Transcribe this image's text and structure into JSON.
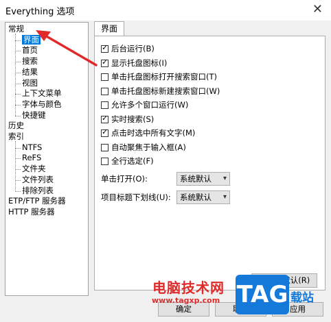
{
  "window": {
    "title": "Everything 选项",
    "close_icon": "close-icon"
  },
  "tree": {
    "items": [
      {
        "label": "常规",
        "level": 0
      },
      {
        "label": "界面",
        "level": 1,
        "selected": true
      },
      {
        "label": "首页",
        "level": 1
      },
      {
        "label": "搜索",
        "level": 1
      },
      {
        "label": "结果",
        "level": 1
      },
      {
        "label": "视图",
        "level": 1
      },
      {
        "label": "上下文菜单",
        "level": 1
      },
      {
        "label": "字体与颜色",
        "level": 1
      },
      {
        "label": "快捷键",
        "level": 1
      },
      {
        "label": "历史",
        "level": 0
      },
      {
        "label": "索引",
        "level": 0
      },
      {
        "label": "NTFS",
        "level": 1
      },
      {
        "label": "ReFS",
        "level": 1
      },
      {
        "label": "文件夹",
        "level": 1
      },
      {
        "label": "文件列表",
        "level": 1
      },
      {
        "label": "排除列表",
        "level": 1
      },
      {
        "label": "ETP/FTP 服务器",
        "level": 0
      },
      {
        "label": "HTTP 服务器",
        "level": 0
      }
    ]
  },
  "tab": {
    "label": "界面"
  },
  "options": [
    {
      "label": "后台运行(B)",
      "checked": true
    },
    {
      "label": "显示托盘图标(I)",
      "checked": true
    },
    {
      "label": "单击托盘图标打开搜索窗口(T)",
      "checked": false
    },
    {
      "label": "单击托盘图标新建搜索窗口(W)",
      "checked": false
    },
    {
      "label": "允许多个窗口运行(W)",
      "checked": false
    },
    {
      "label": "实时搜索(S)",
      "checked": true
    },
    {
      "label": "点击时选中所有文字(M)",
      "checked": true
    },
    {
      "label": "自动聚焦于输入框(A)",
      "checked": false
    },
    {
      "label": "全行选定(F)",
      "checked": false
    }
  ],
  "dropdowns": [
    {
      "label": "单击打开(O):",
      "value": "系统默认"
    },
    {
      "label": "项目标题下划线(U):",
      "value": "系统默认"
    }
  ],
  "buttons": {
    "restore_defaults": "恢复到默认(R)",
    "ok": "确定",
    "cancel": "取消",
    "apply": "应用"
  },
  "watermark": {
    "site_name": "电脑技术网",
    "url": "www.tagxp.com",
    "logo": "TAG",
    "suffix": "载站"
  },
  "colors": {
    "selection": "#0078d7",
    "annotation_arrow": "#e02a2a",
    "watermark_blue": "#1479d8"
  }
}
